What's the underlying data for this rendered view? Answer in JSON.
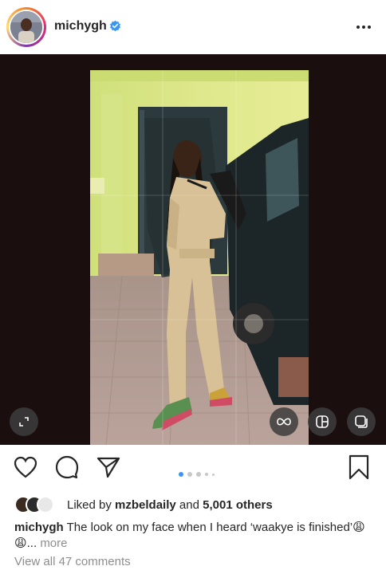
{
  "header": {
    "username": "michygh",
    "verified_icon": "verified-badge-icon",
    "more_icon": "more-options-icon"
  },
  "post": {
    "image_alt": "woman-in-beige-jumpsuit-by-black-suv",
    "carousel_total": 5,
    "carousel_active": 1,
    "overlay_icons": [
      "expand-icon",
      "boomerang-icon",
      "layout-icon",
      "multi-select-icon"
    ]
  },
  "actions": {
    "icons": [
      "heart-icon",
      "comment-icon",
      "share-icon",
      "bookmark-icon"
    ]
  },
  "likes": {
    "prefix": "Liked by",
    "user": "mzbeldaily",
    "middle": "and",
    "count": "5,001 others"
  },
  "caption": {
    "username": "michygh",
    "text": "The look on my face when I heard ‘waakye is finished’😩😩...",
    "more": "more"
  },
  "comments": {
    "label": "View all 47 comments"
  },
  "colors": {
    "accent": "#3897f0",
    "verified": "#3897f0",
    "text": "#262626",
    "muted": "#8e8e8e"
  }
}
